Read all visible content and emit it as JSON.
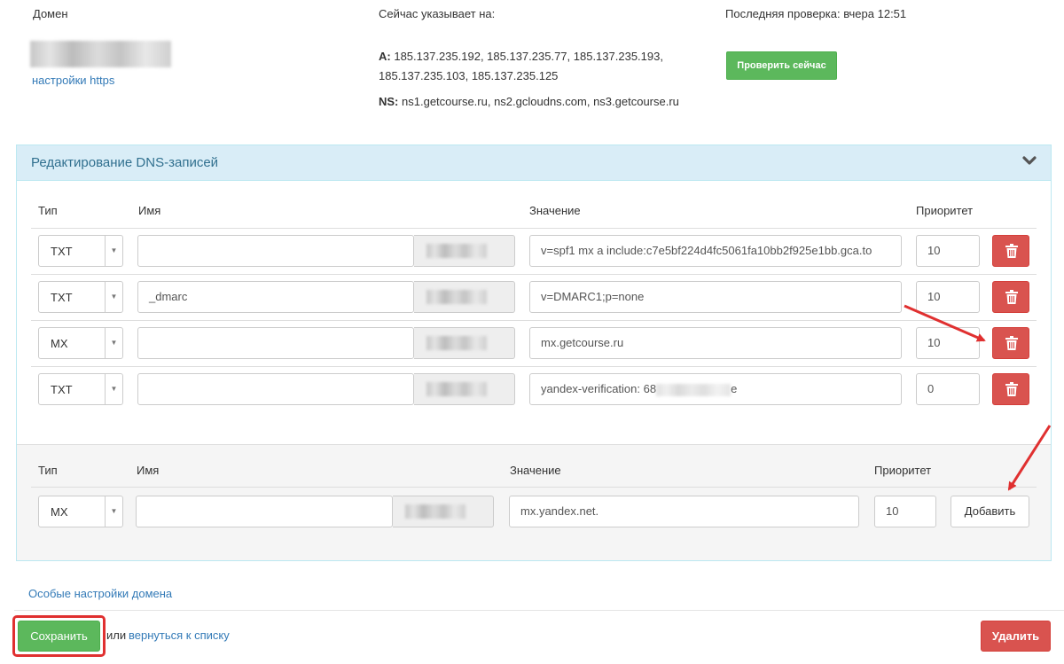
{
  "domain": {
    "label": "Домен",
    "https_link": "настройки https"
  },
  "points_to": {
    "label": "Сейчас указывает на:",
    "a_label": "A:",
    "a_values_line1": "185.137.235.192, 185.137.235.77, 185.137.235.193,",
    "a_values_line2": "185.137.235.103, 185.137.235.125",
    "ns_label": "NS:",
    "ns_values": "ns1.getcourse.ru, ns2.gcloudns.com, ns3.getcourse.ru"
  },
  "last_check": {
    "label": "Последняя проверка: вчера 12:51",
    "check_now_button": "Проверить сейчас"
  },
  "panel": {
    "title": "Редактирование DNS-записей",
    "icon": "chevron-down-icon",
    "columns": {
      "type": "Тип",
      "name": "Имя",
      "value": "Значение",
      "priority": "Приоритет"
    },
    "records": [
      {
        "type": "TXT",
        "name": "",
        "value": "v=spf1 mx a include:c7e5bf224d4fc5061fa10bb2f925e1bb.gca.to",
        "priority": "10"
      },
      {
        "type": "TXT",
        "name": "_dmarc",
        "value": "v=DMARC1;p=none",
        "priority": "10"
      },
      {
        "type": "MX",
        "name": "",
        "value": "mx.getcourse.ru",
        "priority": "10"
      },
      {
        "type": "TXT",
        "name": "",
        "value_prefix": "yandex-verification: 68",
        "value_suffix": "e",
        "priority": "0"
      }
    ],
    "delete_icon": "trash-icon",
    "new_record": {
      "columns": {
        "type": "Тип",
        "name": "Имя",
        "value": "Значение",
        "priority": "Приоритет"
      },
      "type": "MX",
      "name": "",
      "value": "mx.yandex.net.",
      "priority": "10",
      "add_button": "Добавить"
    }
  },
  "footer": {
    "special_settings_link": "Особые настройки домена",
    "save_button": "Сохранить",
    "or_text": "или",
    "back_link": "вернуться к списку",
    "delete_button": "Удалить"
  },
  "colors": {
    "primary_link": "#337ab7",
    "success": "#5cb85c",
    "danger": "#d9534f",
    "panel_header": "#d9edf7",
    "annotation_red": "#e03030"
  }
}
